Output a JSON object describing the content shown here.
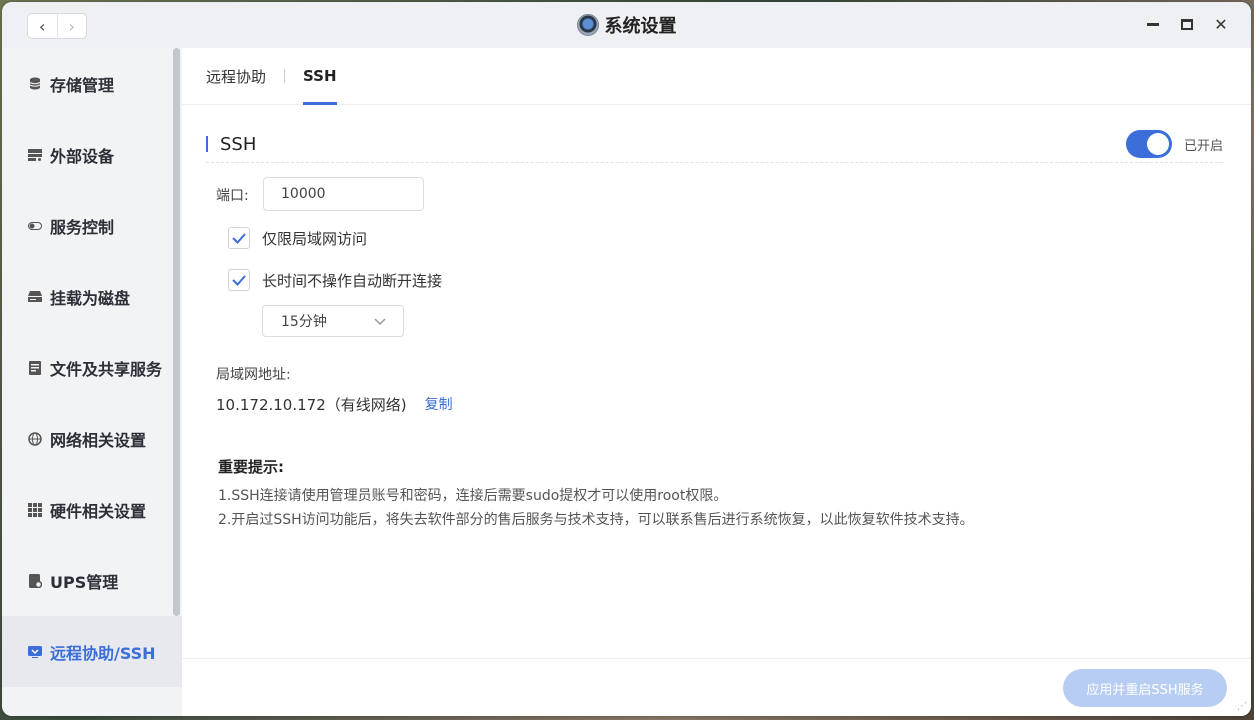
{
  "window": {
    "title": "系统设置",
    "app_icon": "settings-app-icon"
  },
  "nav": {
    "back": "‹",
    "forward": "›"
  },
  "window_controls": {
    "minimize": "minimize-icon",
    "maximize": "maximize-icon",
    "close": "✕"
  },
  "sidebar": {
    "items": [
      {
        "label": "存储管理",
        "icon": "database-icon"
      },
      {
        "label": "外部设备",
        "icon": "external-device-icon"
      },
      {
        "label": "服务控制",
        "icon": "toggle-icon"
      },
      {
        "label": "挂载为磁盘",
        "icon": "drive-icon"
      },
      {
        "label": "文件及共享服务",
        "icon": "file-share-icon"
      },
      {
        "label": "网络相关设置",
        "icon": "network-icon"
      },
      {
        "label": "硬件相关设置",
        "icon": "hardware-grid-icon"
      },
      {
        "label": "UPS管理",
        "icon": "ups-icon"
      },
      {
        "label": "远程协助/SSH",
        "icon": "remote-icon",
        "active": true
      }
    ]
  },
  "tabs": [
    {
      "label": "远程协助",
      "active": false
    },
    {
      "label": "SSH",
      "active": true
    }
  ],
  "ssh": {
    "section_title": "SSH",
    "toggle_state_label": "已开启",
    "port_label": "端口:",
    "port_value": "10000",
    "lan_only_label": "仅限局域网访问",
    "auto_disconnect_label": "长时间不操作自动断开连接",
    "timeout_value": "15分钟",
    "lan_address_label": "局域网地址:",
    "lan_address_value": "10.172.10.172（有线网络)",
    "copy_label": "复制"
  },
  "notice": {
    "title": "重要提示:",
    "lines": [
      "1.SSH连接请使用管理员账号和密码，连接后需要sudo提权才可以使用root权限。",
      "2.开启过SSH访问功能后，将失去软件部分的售后服务与技术支持，可以联系售后进行系统恢复，以此恢复软件技术支持。"
    ]
  },
  "footer": {
    "apply_label": "应用并重启SSH服务"
  },
  "colors": {
    "accent": "#3b6ed8",
    "apply_disabled": "#b8cdf3"
  }
}
